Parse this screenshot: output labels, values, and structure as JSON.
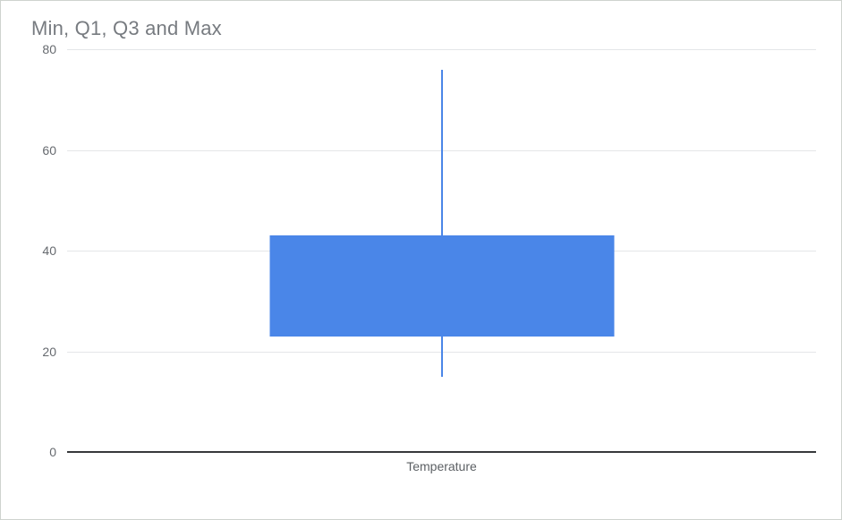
{
  "title": "Min, Q1, Q3 and Max",
  "y_ticks": {
    "t0": "0",
    "t20": "20",
    "t40": "40",
    "t60": "60",
    "t80": "80"
  },
  "x_label": "Temperature",
  "chart_data": {
    "type": "box",
    "title": "Min, Q1, Q3 and Max",
    "xlabel": "Temperature",
    "ylabel": "",
    "ylim": [
      0,
      80
    ],
    "y_ticks": [
      0,
      20,
      40,
      60,
      80
    ],
    "categories": [
      "Temperature"
    ],
    "series": [
      {
        "name": "Temperature",
        "min": 15,
        "q1": 23,
        "q3": 43,
        "max": 76
      }
    ],
    "grid": true
  }
}
